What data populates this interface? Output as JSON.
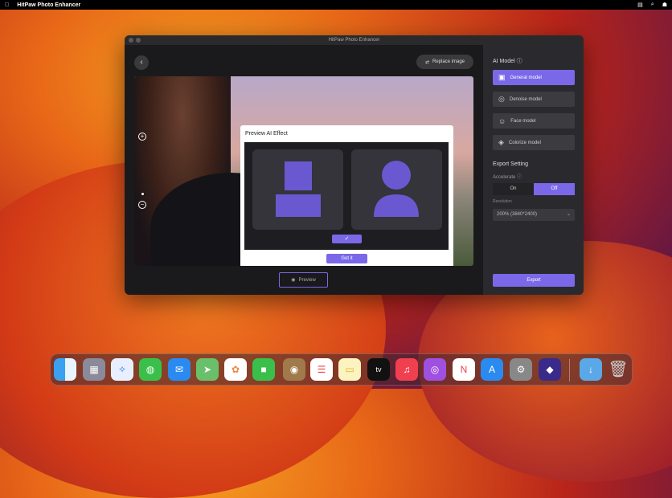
{
  "menubar": {
    "app_name": "HitPaw Photo Enhancer"
  },
  "window": {
    "title": "HitPaw Photo Enhancer",
    "replace_label": "Replace image",
    "preview_label": "Preview"
  },
  "dialog": {
    "title": "Preview AI Effect",
    "got_it": "Got it"
  },
  "panel": {
    "ai_model_label": "AI Model",
    "models": [
      {
        "label": "General model",
        "icon": "image-icon"
      },
      {
        "label": "Denoise model",
        "icon": "denoise-icon"
      },
      {
        "label": "Face model",
        "icon": "face-icon"
      },
      {
        "label": "Colorize model",
        "icon": "colorize-icon"
      }
    ],
    "export_setting": "Export Setting",
    "accelerate": "Accelerate",
    "on": "On",
    "off": "Off",
    "resolution_label": "Resolution",
    "resolution_value": "200% (3840*2400)",
    "export": "Export"
  },
  "dock": [
    "Finder",
    "Launchpad",
    "Safari",
    "Messages",
    "Mail",
    "Maps",
    "Photos",
    "FaceTime",
    "Contacts",
    "Reminders",
    "Notes",
    "TV",
    "Music",
    "Podcasts",
    "News",
    "App Store",
    "System Preferences",
    "HitPaw",
    "Downloads",
    "Trash"
  ],
  "colors": {
    "accent": "#7a68e8"
  }
}
